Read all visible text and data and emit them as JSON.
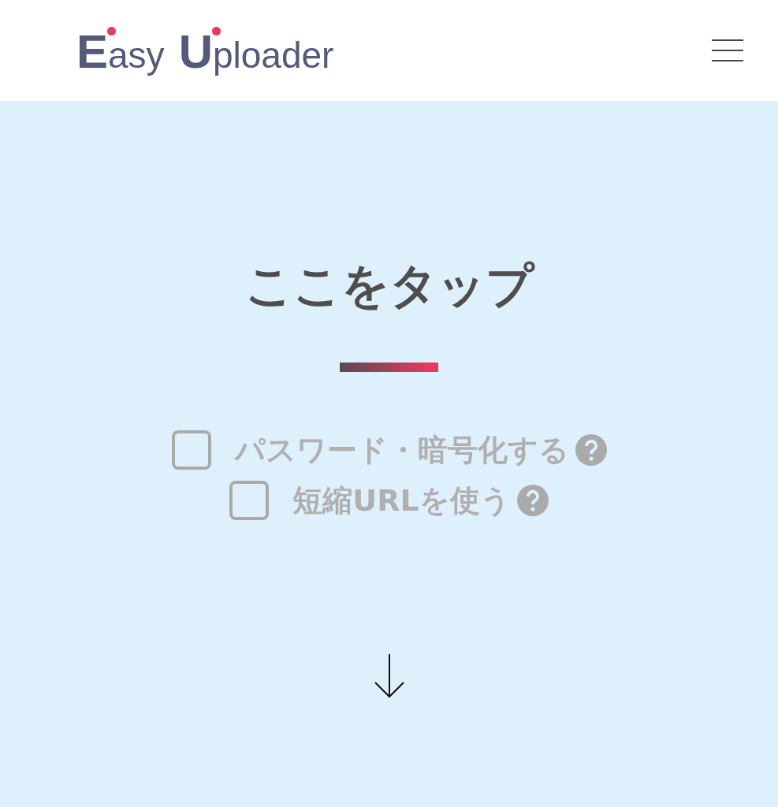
{
  "header": {
    "logo": "Easy Uploader"
  },
  "upload_area": {
    "title": "ここをタップ",
    "options": [
      {
        "label": "パスワード・暗号化する",
        "checked": false
      },
      {
        "label": "短縮URLを使う",
        "checked": false
      }
    ]
  }
}
